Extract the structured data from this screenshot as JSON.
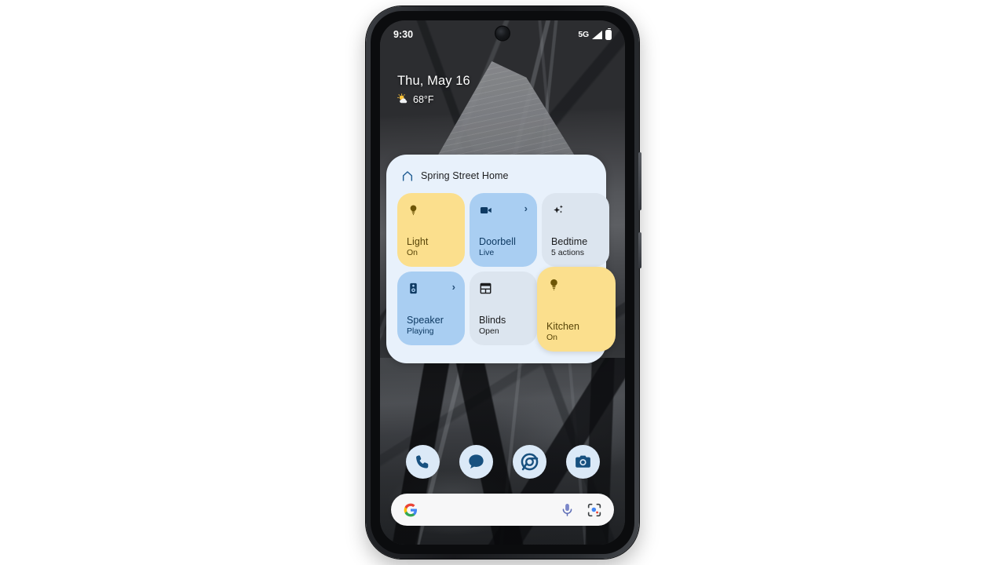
{
  "device": {
    "name": "android-smartphone",
    "screen_label": "home-screen"
  },
  "status_bar": {
    "time": "9:30",
    "network": "5G",
    "signal_icon": "signal-bars-icon",
    "battery_icon": "battery-full-icon",
    "camera_icon": "front-camera-punch-hole"
  },
  "at_a_glance": {
    "date": "Thu, May 16",
    "weather_icon": "partly-sunny-icon",
    "temperature": "68°F"
  },
  "home_widget": {
    "home_icon": "home-house-icon",
    "title": "Spring Street Home",
    "background_color": "#e8f1fb",
    "tiles": [
      {
        "id": "light",
        "icon": "light-bulb-icon",
        "label": "Light",
        "status": "On",
        "color": "yellow",
        "bg": "#fbdf8d",
        "fg": "#584509",
        "chevron": false
      },
      {
        "id": "doorbell",
        "icon": "video-camera-icon",
        "label": "Doorbell",
        "status": "Live",
        "color": "blue",
        "bg": "#a9cef2",
        "fg": "#0e3a63",
        "chevron": true
      },
      {
        "id": "bedtime",
        "icon": "sparkle-stars-icon",
        "label": "Bedtime",
        "status": "5 actions",
        "color": "grey",
        "bg": "#dce5ef",
        "fg": "#1b1c1e",
        "chevron": false
      },
      {
        "id": "speaker",
        "icon": "speaker-icon",
        "label": "Speaker",
        "status": "Playing",
        "color": "blue",
        "bg": "#a9cef2",
        "fg": "#0e3a63",
        "chevron": true
      },
      {
        "id": "blinds",
        "icon": "blinds-window-icon",
        "label": "Blinds",
        "status": "Open",
        "color": "grey",
        "bg": "#dce5ef",
        "fg": "#1b1c1e",
        "chevron": false
      },
      {
        "id": "kitchen",
        "icon": "light-bulb-icon",
        "label": "Kitchen",
        "status": "On",
        "color": "yellow",
        "bg": "#fbdf8d",
        "fg": "#584509",
        "chevron": false,
        "expanded": true
      }
    ]
  },
  "dock": {
    "items": [
      {
        "id": "phone",
        "icon": "phone-handset-icon",
        "label": "Phone"
      },
      {
        "id": "messages",
        "icon": "message-bubble-icon",
        "label": "Messages"
      },
      {
        "id": "chrome",
        "icon": "chrome-browser-icon",
        "label": "Chrome"
      },
      {
        "id": "camera",
        "icon": "camera-icon",
        "label": "Camera"
      }
    ]
  },
  "search": {
    "google_icon": "google-g-logo",
    "placeholder": "",
    "value": "",
    "mic_icon": "microphone-icon",
    "lens_icon": "google-lens-icon"
  },
  "colors": {
    "widget_bg": "#e8f1fb",
    "tile_yellow": "#fbdf8d",
    "tile_blue": "#a9cef2",
    "tile_grey": "#dce5ef",
    "accent_navy": "#0e3a63",
    "dock_circle": "#dbe9f7"
  }
}
